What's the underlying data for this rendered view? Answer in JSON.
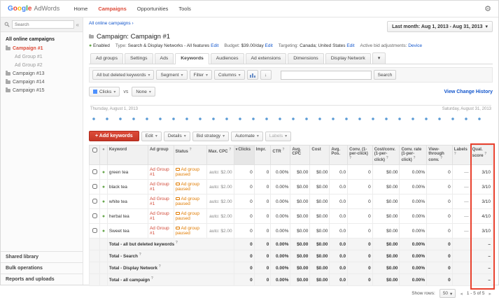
{
  "ui": {
    "help_mark": "?",
    "dropdown_arrow": "▾",
    "collapse_icon": "«",
    "gear": "⚙",
    "bullet": "●",
    "sort_arrow": "▾",
    "crumb_sep": "›",
    "prev": "◂",
    "next": "▸",
    "down_arrow": "↓"
  },
  "topbar": {
    "logo_letters": [
      "G",
      "o",
      "o",
      "g",
      "l",
      "e"
    ],
    "logo_product": "AdWords",
    "nav": [
      {
        "label": "Home"
      },
      {
        "label": "Campaigns"
      },
      {
        "label": "Opportunities"
      },
      {
        "label": "Tools"
      }
    ]
  },
  "sidebar": {
    "search_placeholder": "Search",
    "all_campaigns": "All online campaigns",
    "items": [
      {
        "label": "Campaign #1"
      },
      {
        "label": "Ad Group #1"
      },
      {
        "label": "Ad Group #2"
      },
      {
        "label": "Campaign #13"
      },
      {
        "label": "Campaign #14"
      },
      {
        "label": "Campaign #15"
      }
    ],
    "bottom": [
      {
        "label": "Shared library"
      },
      {
        "label": "Bulk operations"
      },
      {
        "label": "Reports and uploads"
      }
    ]
  },
  "header": {
    "breadcrumb": "All online campaigns",
    "title": "Campaign: Campaign #1",
    "date_range": "Last month: Aug 1, 2013 - Aug 31, 2013",
    "status": {
      "enabled": "Enabled",
      "type_key": "Type:",
      "type_val": "Search & Display Networks - All features",
      "edit": "Edit",
      "budget_key": "Budget:",
      "budget_val": "$39.00/day",
      "targeting_key": "Targeting:",
      "targeting_val": "Canada; United States",
      "bid_key": "Active bid adjustments:",
      "bid_val": "Device"
    }
  },
  "tabs": {
    "items": [
      {
        "label": "Ad groups"
      },
      {
        "label": "Settings"
      },
      {
        "label": "Ads"
      },
      {
        "label": "Keywords"
      },
      {
        "label": "Audiences"
      },
      {
        "label": "Ad extensions"
      },
      {
        "label": "Dimensions"
      },
      {
        "label": "Display Network"
      }
    ]
  },
  "filterbar": {
    "buttons": [
      {
        "label": "All but deleted keywords"
      },
      {
        "label": "Segment"
      },
      {
        "label": "Filter"
      },
      {
        "label": "Columns"
      }
    ],
    "search_label": "Search"
  },
  "chartbar": {
    "metric": "Clicks",
    "vs": "vs",
    "compare": "None",
    "history_link": "View Change History",
    "start_date": "Thursday, August 1, 2013",
    "end_date": "Saturday, August 31, 2013"
  },
  "toolbar": {
    "add": "+ Add keywords",
    "menus": [
      {
        "label": "Edit"
      },
      {
        "label": "Details"
      },
      {
        "label": "Bid strategy"
      },
      {
        "label": "Automate"
      },
      {
        "label": "Labels"
      }
    ]
  },
  "table": {
    "headers": {
      "keyword": "Keyword",
      "ad_group": "Ad group",
      "status": "Status",
      "max_cpc": "Max. CPC",
      "clicks": "Clicks",
      "impr": "Impr.",
      "ctr": "CTR",
      "avg_cpc": "Avg. CPC",
      "cost": "Cost",
      "avg_pos": "Avg. Pos.",
      "conv": "Conv. (1-per-click)",
      "cost_conv": "Cost/conv. (1-per-click)",
      "conv_rate": "Conv. rate (1-per-click)",
      "view_through": "View-through conv.",
      "labels": "Labels",
      "qual": "Qual. score"
    },
    "rows": [
      {
        "keyword": "green tea",
        "ad_group": "Ad Group #1",
        "status": "Ad group paused",
        "max_cpc": "auto: $2.00",
        "clicks": "0",
        "impr": "0",
        "ctr": "0.00%",
        "avg_cpc": "$0.00",
        "cost": "$0.00",
        "avg_pos": "0.0",
        "conv": "0",
        "cost_conv": "$0.00",
        "conv_rate": "0.00%",
        "view_through": "0",
        "labels": "—",
        "qual": "3/10"
      },
      {
        "keyword": "black tea",
        "ad_group": "Ad Group #1",
        "status": "Ad group paused",
        "max_cpc": "auto: $2.00",
        "clicks": "0",
        "impr": "0",
        "ctr": "0.00%",
        "avg_cpc": "$0.00",
        "cost": "$0.00",
        "avg_pos": "0.0",
        "conv": "0",
        "cost_conv": "$0.00",
        "conv_rate": "0.00%",
        "view_through": "0",
        "labels": "—",
        "qual": "3/10"
      },
      {
        "keyword": "white tea",
        "ad_group": "Ad Group #1",
        "status": "Ad group paused",
        "max_cpc": "auto: $2.00",
        "clicks": "0",
        "impr": "0",
        "ctr": "0.00%",
        "avg_cpc": "$0.00",
        "cost": "$0.00",
        "avg_pos": "0.0",
        "conv": "0",
        "cost_conv": "$0.00",
        "conv_rate": "0.00%",
        "view_through": "0",
        "labels": "—",
        "qual": "3/10"
      },
      {
        "keyword": "herbal tea",
        "ad_group": "Ad Group #1",
        "status": "Ad group paused",
        "max_cpc": "auto: $2.00",
        "clicks": "0",
        "impr": "0",
        "ctr": "0.00%",
        "avg_cpc": "$0.00",
        "cost": "$0.00",
        "avg_pos": "0.0",
        "conv": "0",
        "cost_conv": "$0.00",
        "conv_rate": "0.00%",
        "view_through": "0",
        "labels": "—",
        "qual": "4/10"
      },
      {
        "keyword": "Sweet tea",
        "ad_group": "Ad Group #1",
        "status": "Ad group paused",
        "max_cpc": "auto: $2.00",
        "clicks": "0",
        "impr": "0",
        "ctr": "0.00%",
        "avg_cpc": "$0.00",
        "cost": "$0.00",
        "avg_pos": "0.0",
        "conv": "0",
        "cost_conv": "$0.00",
        "conv_rate": "0.00%",
        "view_through": "0",
        "labels": "—",
        "qual": "3/10"
      }
    ],
    "totals": [
      {
        "label": "Total - all but deleted keywords",
        "clicks": "0",
        "impr": "0",
        "ctr": "0.00%",
        "avg_cpc": "$0.00",
        "cost": "$0.00",
        "avg_pos": "0.0",
        "conv": "0",
        "cost_conv": "$0.00",
        "conv_rate": "0.00%",
        "view_through": "0",
        "qual": "–"
      },
      {
        "label": "Total - Search",
        "clicks": "0",
        "impr": "0",
        "ctr": "0.00%",
        "avg_cpc": "$0.00",
        "cost": "$0.00",
        "avg_pos": "0.0",
        "conv": "0",
        "cost_conv": "$0.00",
        "conv_rate": "0.00%",
        "view_through": "0",
        "qual": "–"
      },
      {
        "label": "Total - Display Network",
        "clicks": "0",
        "impr": "0",
        "ctr": "0.00%",
        "avg_cpc": "$0.00",
        "cost": "$0.00",
        "avg_pos": "0.0",
        "conv": "0",
        "cost_conv": "$0.00",
        "conv_rate": "0.00%",
        "view_through": "0",
        "qual": "–"
      },
      {
        "label": "Total - all campaign",
        "clicks": "0",
        "impr": "0",
        "ctr": "0.00%",
        "avg_cpc": "$0.00",
        "cost": "$0.00",
        "avg_pos": "0.0",
        "conv": "0",
        "cost_conv": "$0.00",
        "conv_rate": "0.00%",
        "view_through": "0",
        "qual": "–"
      }
    ],
    "footer": {
      "show_rows": "Show rows:",
      "rows_value": "50",
      "range": "1 - 5 of 5"
    }
  }
}
